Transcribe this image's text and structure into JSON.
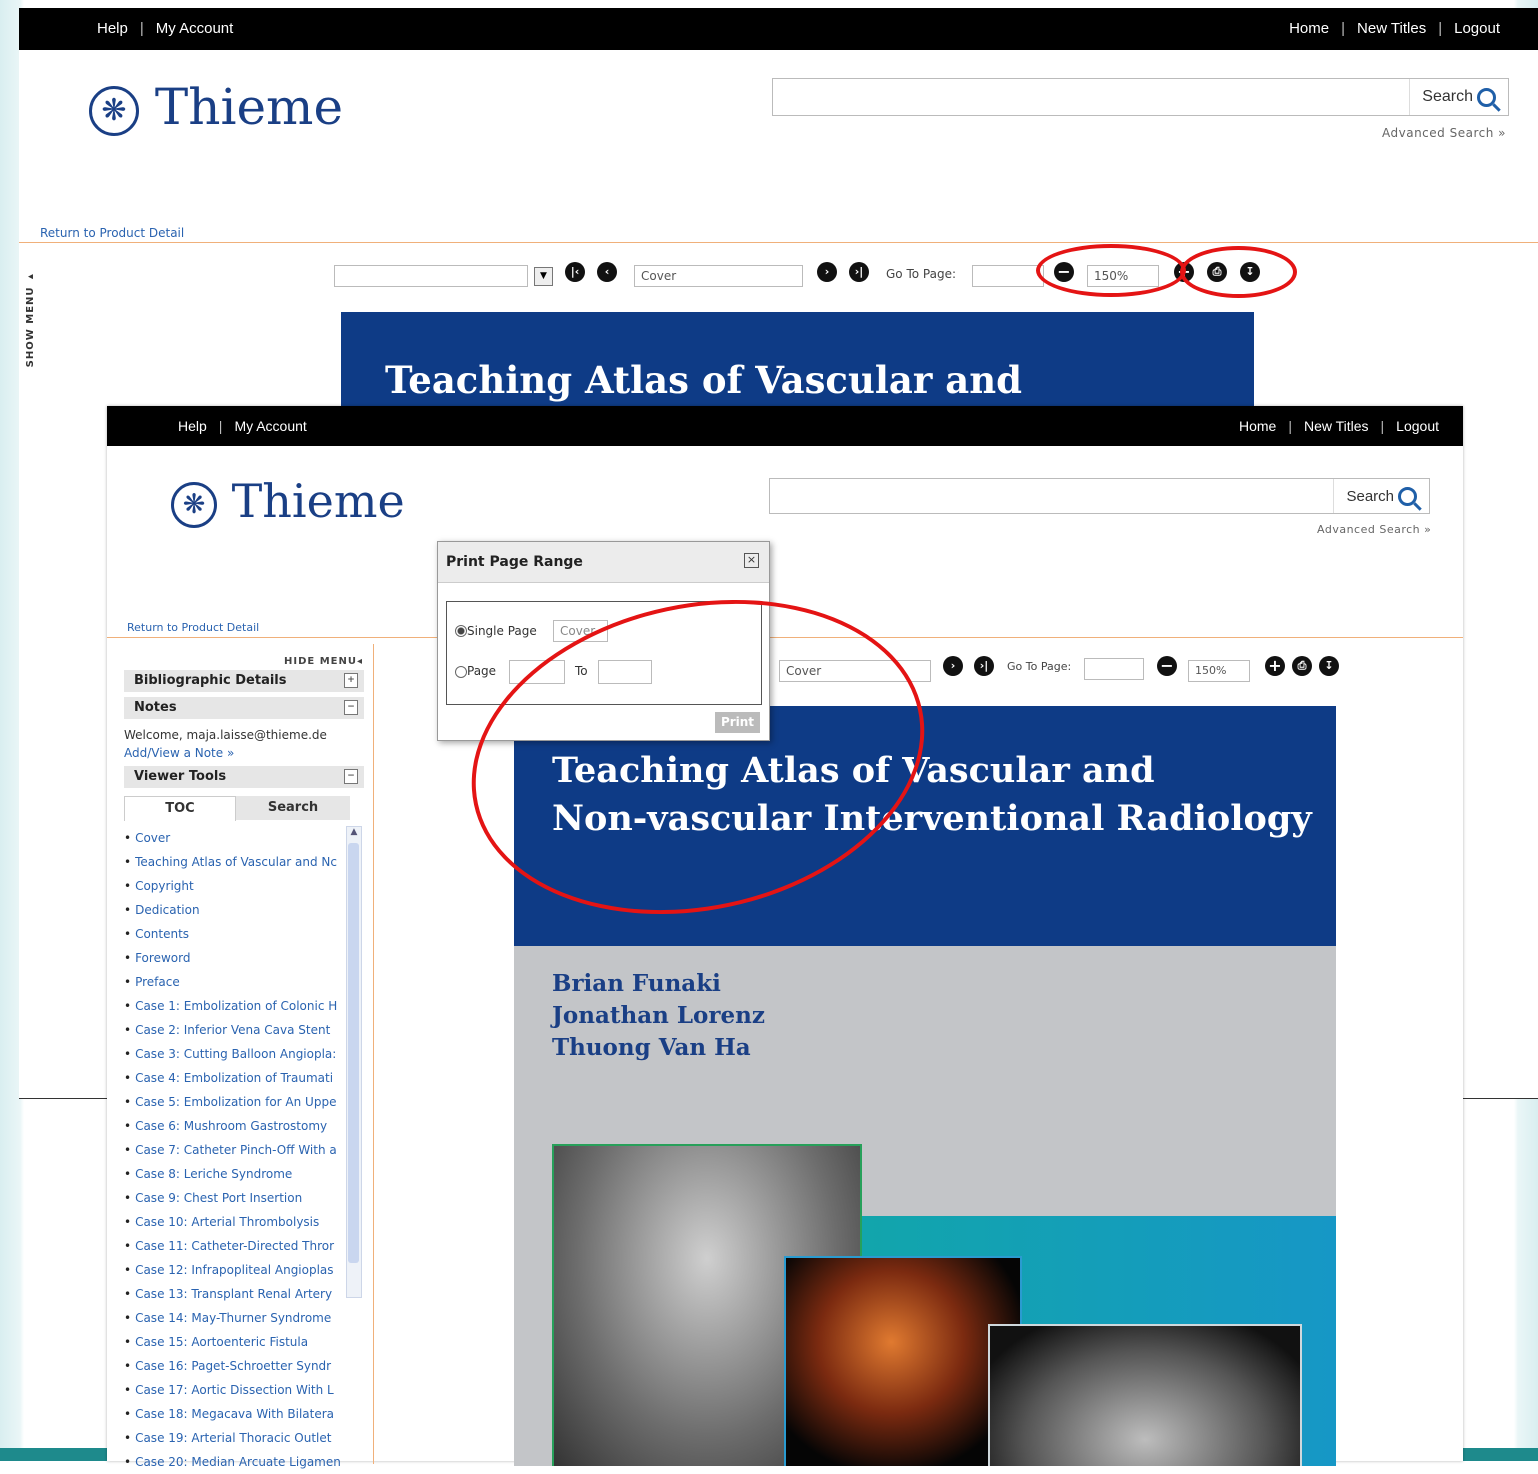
{
  "nav": {
    "help": "Help",
    "account": "My Account",
    "home": "Home",
    "new_titles": "New Titles",
    "logout": "Logout"
  },
  "brand": {
    "name": "Thieme"
  },
  "search": {
    "button": "Search",
    "advanced": "Advanced Search »",
    "value": ""
  },
  "return_link": "Return to Product Detail",
  "show_menu": "SHOW MENU ▸",
  "toolbar": {
    "current_page": "Cover",
    "goto_label": "Go To Page:",
    "zoom": "150%",
    "goto_value": ""
  },
  "book": {
    "title_line1": "Teaching Atlas of Vascular and",
    "title_line2": "Non-vascular Interventional Radiology",
    "authors": [
      "Brian Funaki",
      "Jonathan Lorenz",
      "Thuong Van Ha"
    ]
  },
  "sidebar": {
    "hide_menu": "HIDE MENU◂",
    "bibliographic": "Bibliographic Details",
    "notes": "Notes",
    "welcome": "Welcome, maja.laisse@thieme.de",
    "add_note": "Add/View a Note »",
    "viewer_tools": "Viewer Tools",
    "tab_toc": "TOC",
    "tab_search": "Search",
    "toc": [
      "Cover",
      "Teaching Atlas of Vascular and Nc",
      "Copyright",
      "Dedication",
      "Contents",
      "Foreword",
      "Preface",
      "Case 1: Embolization of Colonic H",
      "Case 2: Inferior Vena Cava Stent",
      "Case 3: Cutting Balloon Angiopla:",
      "Case 4: Embolization of Traumati",
      "Case 5: Embolization for An Uppe",
      "Case 6: Mushroom Gastrostomy",
      "Case 7: Catheter Pinch-Off With a",
      "Case 8: Leriche Syndrome",
      "Case 9: Chest Port Insertion",
      "Case 10: Arterial Thrombolysis",
      "Case 11: Catheter-Directed Thror",
      "Case 12: Infrapopliteal Angioplas",
      "Case 13: Transplant Renal Artery",
      "Case 14: May-Thurner Syndrome",
      "Case 15: Aortoenteric Fistula",
      "Case 16: Paget-Schroetter Syndr",
      "Case 17: Aortic Dissection With L",
      "Case 18: Megacava With Bilatera",
      "Case 19: Arterial Thoracic Outlet",
      "Case 20: Median Arcuate Ligamen"
    ]
  },
  "print_dialog": {
    "title": "Print Page Range",
    "single_page": "Single Page",
    "single_value": "Cover",
    "page": "Page",
    "to": "To",
    "print": "Print"
  }
}
